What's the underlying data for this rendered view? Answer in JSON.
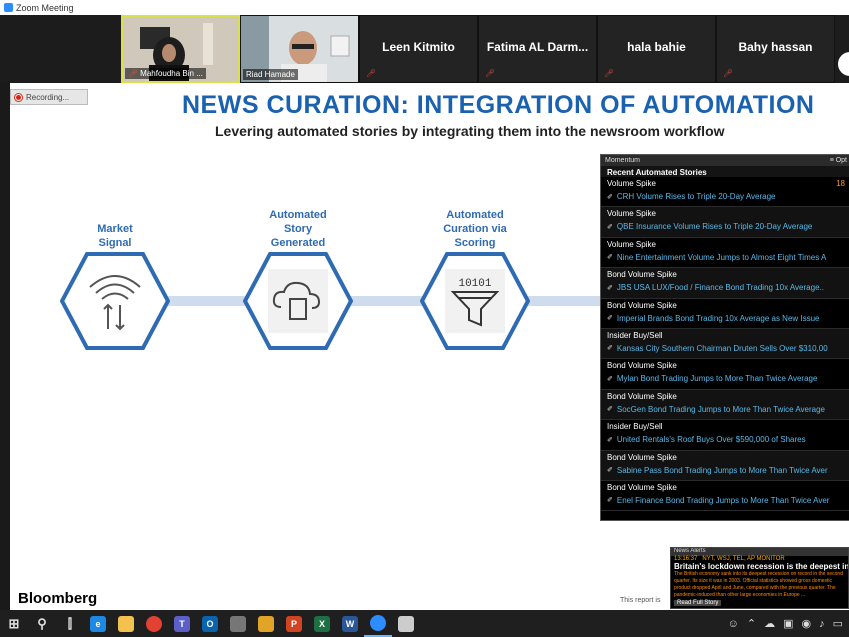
{
  "window": {
    "title": "Zoom Meeting"
  },
  "participants": [
    {
      "name": "Mahfoudha Bin ...",
      "muted": true,
      "video": true
    },
    {
      "name": "Riad Hamade",
      "muted": false,
      "video": true
    },
    {
      "name": "Leen Kitmito",
      "muted": true,
      "video": false
    },
    {
      "name": "Fatima AL Darm...",
      "muted": true,
      "video": false
    },
    {
      "name": "hala bahie",
      "muted": true,
      "video": false
    },
    {
      "name": "Bahy hassan",
      "muted": true,
      "video": false
    }
  ],
  "recording": {
    "label": "Recording..."
  },
  "slide": {
    "title": "NEWS CURATION: INTEGRATION OF AUTOMATION",
    "subtitle": "Levering automated stories by integrating them into the newsroom workflow",
    "steps": [
      {
        "label_lines": [
          "Market",
          "Signal"
        ],
        "icon": "wifi-transfer-icon"
      },
      {
        "label_lines": [
          "Automated",
          "Story",
          "Generated"
        ],
        "icon": "cloud-document-icon"
      },
      {
        "label_lines": [
          "Automated",
          "Curation via",
          "Scoring"
        ],
        "icon": "binary-funnel-icon"
      }
    ],
    "funnel_digits": "10101",
    "brand": "Bloomberg",
    "footer_note": "This report is"
  },
  "momentum": {
    "panel_title": "Momentum",
    "options_label": "≡ Opt",
    "section_title": "Recent Automated Stories",
    "first_count": "18",
    "stories": [
      {
        "category": "Volume Spike",
        "headline": "CRH Volume Rises to Triple 20-Day Average"
      },
      {
        "category": "Volume Spike",
        "headline": "QBE Insurance Volume Rises to Triple 20-Day Average"
      },
      {
        "category": "Volume Spike",
        "headline": "Nine Entertainment Volume Jumps to Almost Eight Times A"
      },
      {
        "category": "Bond Volume Spike",
        "headline": "JBS USA LUX/Food / Finance Bond Trading 10x Average.."
      },
      {
        "category": "Bond Volume Spike",
        "headline": "Imperial Brands Bond Trading 10x Average as New Issue"
      },
      {
        "category": "Insider Buy/Sell",
        "headline": "Kansas City Southern Chairman Druten Sells Over $310,00"
      },
      {
        "category": "Bond Volume Spike",
        "headline": "Mylan Bond Trading Jumps to More Than Twice Average"
      },
      {
        "category": "Bond Volume Spike",
        "headline": "SocGen Bond Trading Jumps to More Than Twice Average"
      },
      {
        "category": "Insider Buy/Sell",
        "headline": "United Rentals's Roof Buys Over $590,000 of Shares"
      },
      {
        "category": "Bond Volume Spike",
        "headline": "Sabine Pass Bond Trading Jumps to More Than Twice Aver"
      },
      {
        "category": "Bond Volume Spike",
        "headline": "Enel Finance Bond Trading Jumps to More Than Twice Aver"
      }
    ]
  },
  "news_alerts": {
    "title": "News Alerts",
    "time": "13:16:37",
    "sources": "NYT, WSJ, TEL, AP MONITOR",
    "headline": "Britain's lockdown recession is the deepest in Europe",
    "body": "The British economy sank into its deepest recession on record in the second quarter. Its size it was in 2003. Official statistics showed gross domestic product dropped April and June, compared with the previous quarter. The pandemic-induced than other large economies in Europe ...",
    "button": "Read Full Story"
  },
  "taskbar": {
    "apps": [
      {
        "name": "start-icon"
      },
      {
        "name": "search-icon"
      },
      {
        "name": "task-view-icon"
      },
      {
        "name": "edge-icon",
        "letter": "e",
        "color": "#1e88e5"
      },
      {
        "name": "file-explorer-icon",
        "letter": "",
        "color": "#f2c14e"
      },
      {
        "name": "chrome-icon",
        "letter": "",
        "color": "#e34133"
      },
      {
        "name": "teams-icon",
        "letter": "T",
        "color": "#5b5fc7"
      },
      {
        "name": "outlook-icon",
        "letter": "O",
        "color": "#0a64ad"
      },
      {
        "name": "camera-icon",
        "letter": "",
        "color": "#777777"
      },
      {
        "name": "folder-icon",
        "letter": "",
        "color": "#e0a526"
      },
      {
        "name": "powerpoint-icon",
        "letter": "P",
        "color": "#d04423"
      },
      {
        "name": "excel-icon",
        "letter": "X",
        "color": "#1d7044"
      },
      {
        "name": "word-icon",
        "letter": "W",
        "color": "#2b579a"
      },
      {
        "name": "zoom-icon",
        "letter": "",
        "color": "#2d8cff"
      },
      {
        "name": "paint-icon",
        "letter": "",
        "color": "#cccccc"
      }
    ]
  },
  "colors": {
    "accent": "#1a62b0",
    "hex_border": "#2e6bb3",
    "alert_orange": "#ff9a1f",
    "link_blue": "#57b9ea"
  }
}
